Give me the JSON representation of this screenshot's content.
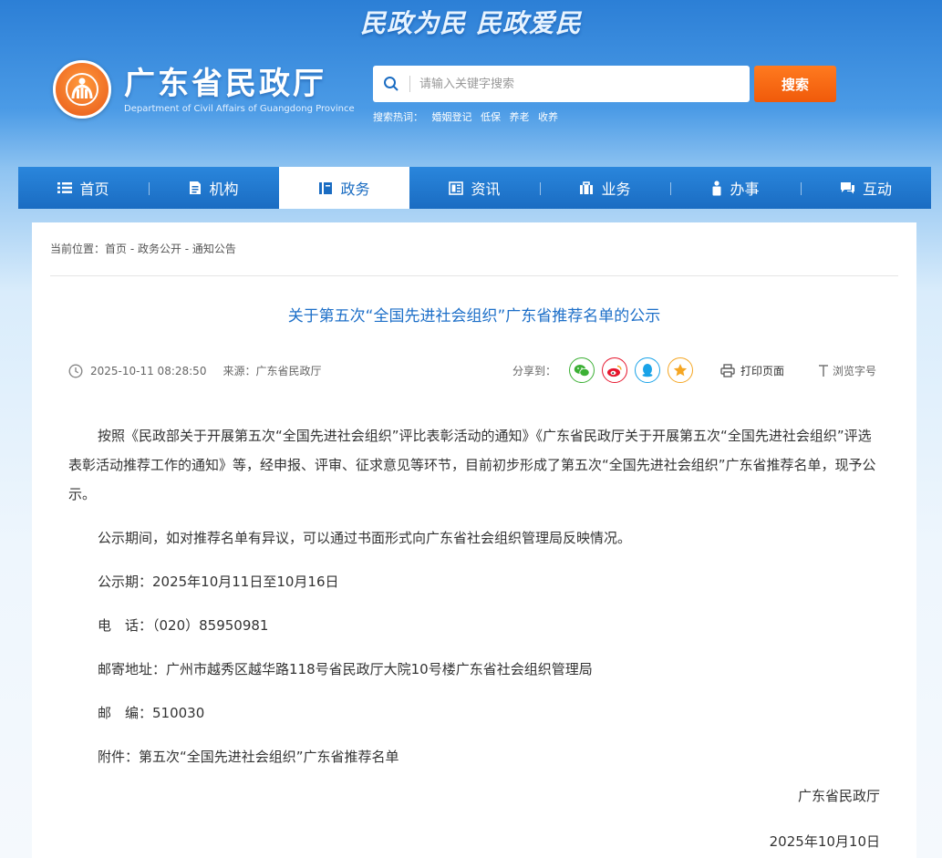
{
  "header": {
    "slogan": "民政为民  民政爱民",
    "site_name": "广东省民政厅",
    "site_name_en": "Department of Civil Affairs of Guangdong Province",
    "search_placeholder": "请输入关键字搜索",
    "search_button": "搜索",
    "hot_label": "搜索热词：",
    "hot_words": [
      "婚姻登记",
      "低保",
      "养老",
      "收养"
    ]
  },
  "nav": {
    "items": [
      {
        "label": "首页",
        "icon": "list-icon"
      },
      {
        "label": "机构",
        "icon": "document-icon"
      },
      {
        "label": "政务",
        "icon": "book-icon"
      },
      {
        "label": "资讯",
        "icon": "newspaper-icon"
      },
      {
        "label": "业务",
        "icon": "briefcase-icon"
      },
      {
        "label": "办事",
        "icon": "person-icon"
      },
      {
        "label": "互动",
        "icon": "chat-icon"
      }
    ],
    "active": "政务"
  },
  "breadcrumb": "当前位置：首页 - 政务公开 - 通知公告",
  "article": {
    "title": "关于第五次“全国先进社会组织”广东省推荐名单的公示",
    "datetime": "2025-10-11 08:28:50",
    "source": "来源：广东省民政厅",
    "share_label": "分享到：",
    "print_label": "打印页面",
    "fontsize_label": "浏览字号",
    "paragraphs": [
      "按照《民政部关于开展第五次“全国先进社会组织”评比表彰活动的通知》《广东省民政厅关于开展第五次“全国先进社会组织”评选表彰活动推荐工作的通知》等，经申报、评审、征求意见等环节，目前初步形成了第五次“全国先进社会组织”广东省推荐名单，现予公示。",
      "公示期间，如对推荐名单有异议，可以通过书面形式向广东省社会组织管理局反映情况。",
      "公示期：2025年10月11日至10月16日",
      "电　话：（020）85950981",
      "邮寄地址：广州市越秀区越华路118号省民政厅大院10号楼广东省社会组织管理局",
      "邮　编：510030",
      "附件：第五次“全国先进社会组织”广东省推荐名单"
    ],
    "signature": "广东省民政厅",
    "sign_date": "2025年10月10日"
  },
  "colors": {
    "nav_blue": "#1a6cc2",
    "title_blue": "#1d6fc8",
    "search_orange": "#f05a0a",
    "wechat_green": "#3cb035",
    "weibo_red": "#e6162d",
    "qq_blue": "#1aa3e8",
    "qzone_yellow": "#f5a623"
  }
}
